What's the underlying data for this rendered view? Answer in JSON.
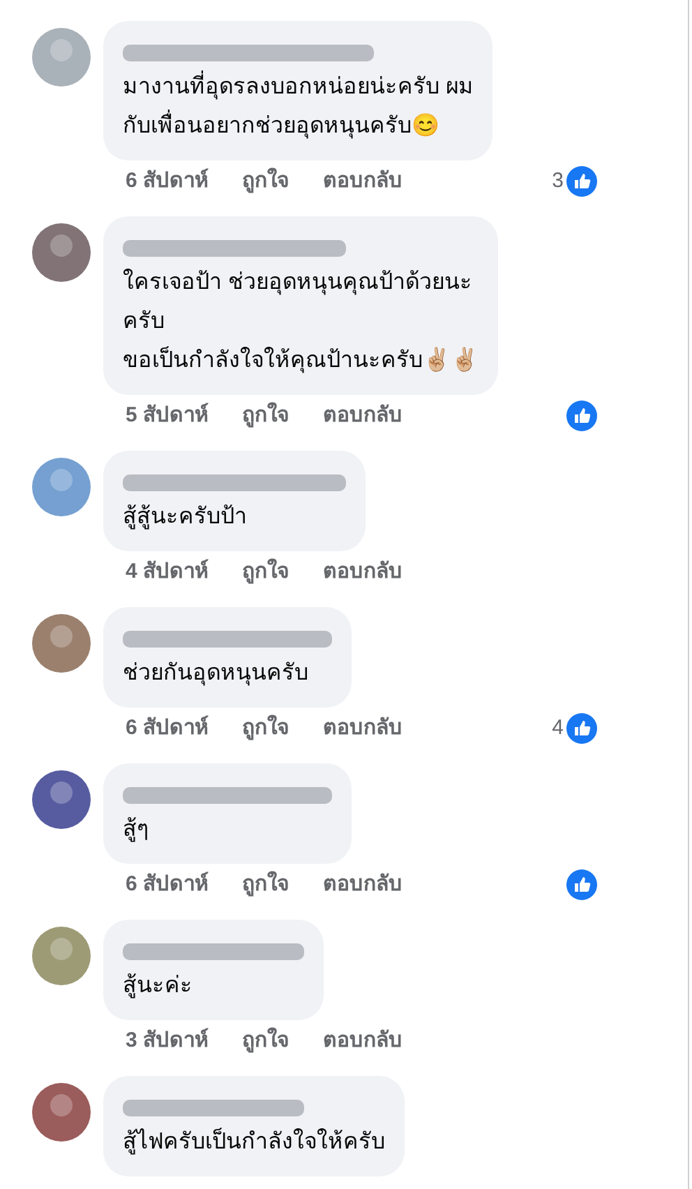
{
  "comments": [
    {
      "lines": [
        "มางานที่อุดรลงบอกหน่อยน่ะครับ ผม",
        "กับเพื่อนอยากช่วยอุดหนุนครับ😊"
      ],
      "time": "6 สัปดาห์",
      "like": "ถูกใจ",
      "reply": "ตอบกลับ",
      "reaction": true,
      "reaction_count": "3"
    },
    {
      "lines": [
        "ใครเจอป้า ช่วยอุดหนุนคุณป้าด้วยนะ",
        "ครับ",
        "ขอเป็นกำลังใจให้คุณป้านะครับ✌🏼✌🏼"
      ],
      "time": "5 สัปดาห์",
      "like": "ถูกใจ",
      "reply": "ตอบกลับ",
      "reaction": true
    },
    {
      "lines": [
        "สู้สู้นะครับป้า"
      ],
      "time": "4 สัปดาห์",
      "like": "ถูกใจ",
      "reply": "ตอบกลับ",
      "reaction": false
    },
    {
      "lines": [
        "ช่วยกันอุดหนุนครับ"
      ],
      "time": "6 สัปดาห์",
      "like": "ถูกใจ",
      "reply": "ตอบกลับ",
      "reaction": true,
      "reaction_count": "4"
    },
    {
      "lines": [
        "สู้ๆ"
      ],
      "time": "6 สัปดาห์",
      "like": "ถูกใจ",
      "reply": "ตอบกลับ",
      "reaction": true
    },
    {
      "lines": [
        "สู้นะค่ะ"
      ],
      "time": "3 สัปดาห์",
      "like": "ถูกใจ",
      "reply": "ตอบกลับ",
      "reaction": false
    },
    {
      "lines": [
        "สู้ไฟครับเป็นกำลังใจให้ครับ"
      ]
    }
  ]
}
